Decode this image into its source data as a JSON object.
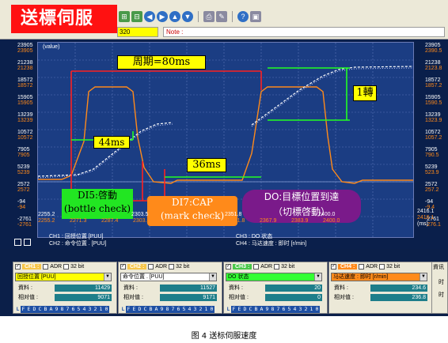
{
  "app_title": "送標伺服",
  "toolbar": {
    "value_field": "320",
    "note_label": "Note :"
  },
  "scope": {
    "unit_label": "(value)",
    "left_axis": [
      {
        "white": "23905",
        "orange": "23905"
      },
      {
        "white": "21238",
        "orange": "21238"
      },
      {
        "white": "18572",
        "orange": "18572"
      },
      {
        "white": "15905",
        "orange": "15905"
      },
      {
        "white": "13239",
        "orange": "13239"
      },
      {
        "white": "10572",
        "orange": "10572"
      },
      {
        "white": "7905",
        "orange": "7905"
      },
      {
        "white": "5239",
        "orange": "5239"
      },
      {
        "white": "2572",
        "orange": "2572"
      },
      {
        "white": "-94",
        "orange": "-94"
      },
      {
        "white": "-2761",
        "orange": "-2761"
      }
    ],
    "right_axis": [
      {
        "white": "23905",
        "orange": "2390.5"
      },
      {
        "white": "21238",
        "orange": "2123.8"
      },
      {
        "white": "18572",
        "orange": "1857.2"
      },
      {
        "white": "15905",
        "orange": "1590.5"
      },
      {
        "white": "13239",
        "orange": "1323.9"
      },
      {
        "white": "10572",
        "orange": "1057.2"
      },
      {
        "white": "7905",
        "orange": "790.5"
      },
      {
        "white": "5239",
        "orange": "523.9"
      },
      {
        "white": "2572",
        "orange": "257.2"
      },
      {
        "white": "-94",
        "orange": "-9.4"
      },
      {
        "white": "-2761",
        "orange": "-276.1"
      }
    ],
    "x_ticks_white": [
      "2255.2",
      "2303.5",
      "2351.8",
      "2400.0"
    ],
    "x_ticks_orange": [
      "2255.2",
      "2271.3",
      "2287.4",
      "2303.5",
      "2319.6",
      "2335.7",
      "2351.8",
      "2367.9",
      "2383.9",
      "2400.0"
    ],
    "x_right_white": "2416.1",
    "x_right_orange": "2416.1",
    "x_unit": "(ms)",
    "legend": {
      "ch1": "CH1 : 回授位置 [PUU]",
      "ch2": "CH2 : 命令位置 . [PUU]",
      "ch3": "CH3 : DO 状态",
      "ch4": "CH4 : 马达速度 : 即时 [r/min]"
    },
    "annotations": {
      "period": "周期=80ms",
      "t44": "44ms",
      "t36": "36ms",
      "turn": "1轉",
      "di5_line1": "DI5:啓動",
      "di5_line2": "(bottle check)",
      "di7_line1": "DI7:CAP",
      "di7_line2": "(mark check)",
      "do_line1": "DO:目標位置到達",
      "do_line2": "（切標啓動）"
    }
  },
  "panels": [
    {
      "name": "CH1 :",
      "color": "#f7c64a",
      "adr": "ADR",
      "bit": "32 bit",
      "select": "回授位置 [PUU]",
      "select_bg": "#ffff00",
      "data_label": "資料 :",
      "data_value": "11429",
      "rel_label": "相对值 :",
      "rel_value": "9071",
      "bits": [
        "L",
        "F",
        "E",
        "D",
        "C",
        "B",
        "A",
        "9",
        "8",
        "7",
        "6",
        "5",
        "4",
        "3",
        "2",
        "1",
        "0"
      ]
    },
    {
      "name": "CH2 :",
      "color": "#f7c64a",
      "adr": "ADR",
      "bit": "32 bit",
      "select": "命令位置 . [PUU]",
      "select_bg": "#ffffff",
      "data_label": "資料 :",
      "data_value": "11527",
      "rel_label": "相对值 :",
      "rel_value": "9171",
      "bits": [
        "L",
        "F",
        "E",
        "D",
        "C",
        "B",
        "A",
        "9",
        "8",
        "7",
        "6",
        "5",
        "4",
        "3",
        "2",
        "1",
        "0"
      ]
    },
    {
      "name": "CH3 :",
      "color": "#4ac84a",
      "adr": "ADR",
      "bit": "32 bit",
      "select": "DO 状态",
      "select_bg": "#33ff33",
      "data_label": "資料 :",
      "data_value": "20",
      "rel_label": "相对值 :",
      "rel_value": "0",
      "bits": [
        "L",
        "F",
        "E",
        "D",
        "C",
        "B",
        "A",
        "9",
        "8",
        "7",
        "6",
        "5",
        "4",
        "3",
        "2",
        "1",
        "0"
      ]
    },
    {
      "name": "CH4 :",
      "color": "#ff8a1a",
      "adr": "ADR",
      "bit": "32 bit",
      "select": "马达速度 : 即时 [r/min]",
      "select_bg": "#ff8a1a",
      "data_label": "資料 :",
      "data_value": "234.6",
      "rel_label": "相对值 :",
      "rel_value": "236.8",
      "bits": []
    }
  ],
  "extra_panel": {
    "title": "資讯",
    "line1": "时",
    "line2": "时"
  },
  "caption": "图 4 送标伺服速度"
}
